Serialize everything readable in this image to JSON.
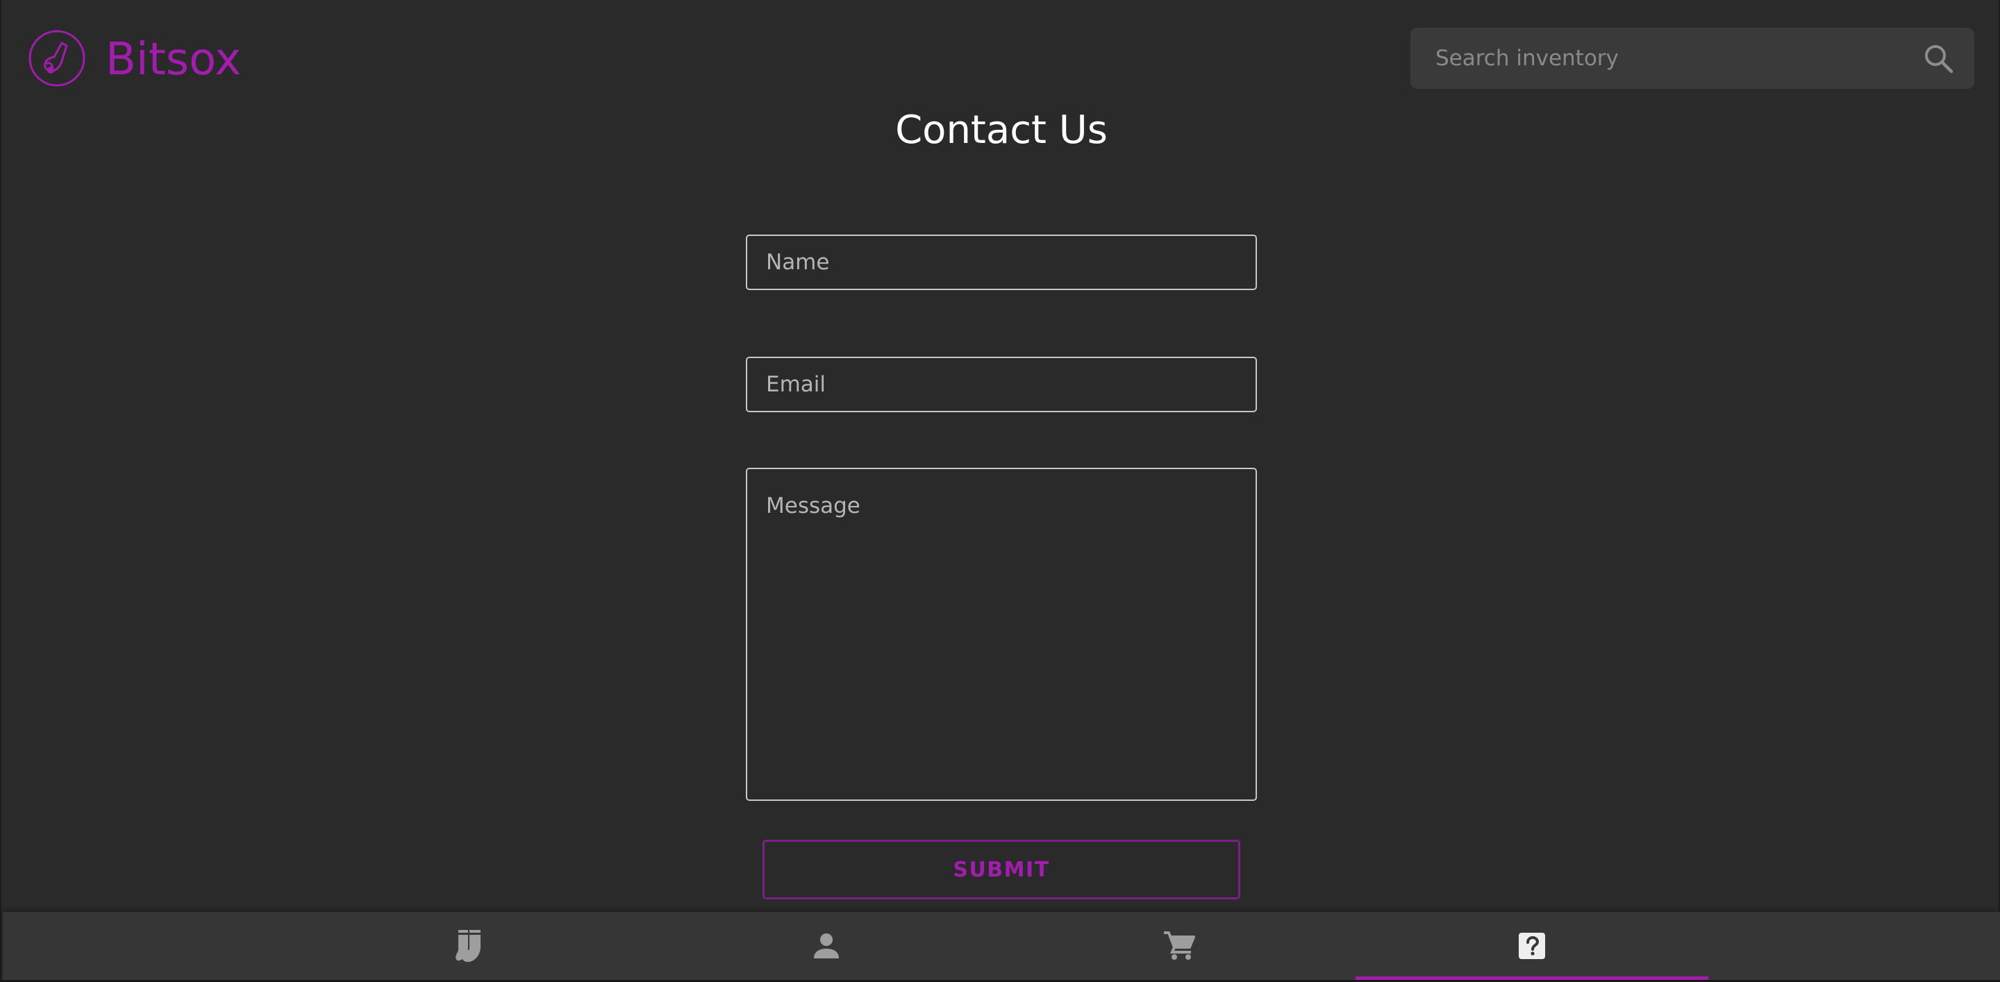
{
  "brand": {
    "name": "Bitsox",
    "logo_icon": "sock-logo-icon",
    "color": "#a21cae"
  },
  "search": {
    "placeholder": "Search inventory",
    "value": "",
    "icon": "search-icon"
  },
  "page": {
    "title": "Contact Us"
  },
  "form": {
    "name_placeholder": "Name",
    "name_value": "",
    "email_placeholder": "Email",
    "email_value": "",
    "message_placeholder": "Message",
    "message_value": "",
    "submit_label": "SUBMIT"
  },
  "bottom_nav": {
    "items": [
      {
        "icon": "socks-icon",
        "active": false
      },
      {
        "icon": "person-icon",
        "active": false
      },
      {
        "icon": "cart-icon",
        "active": false
      },
      {
        "icon": "help-icon",
        "active": true
      }
    ]
  },
  "colors": {
    "background": "#2a2a2a",
    "accent": "#a21cae",
    "nav_background": "#363636",
    "search_background": "#3a3a3a"
  }
}
